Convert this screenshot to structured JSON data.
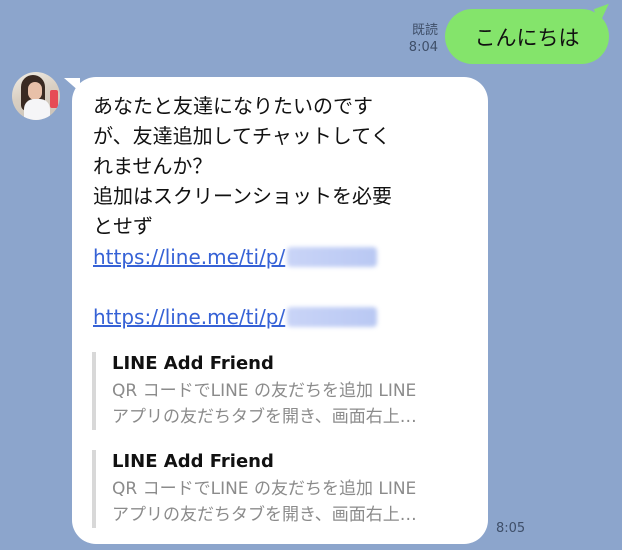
{
  "sent_message": {
    "read_label": "既読",
    "time": "8:04",
    "text": "こんにちは"
  },
  "received_message": {
    "lines": [
      "あなたと友達になりたいのです",
      "が、友達追加してチャットしてく",
      "れませんか？",
      "追加はスクリーンショットを必要",
      "とせず"
    ],
    "links": [
      "https://line.me/ti/p/",
      "https://line.me/ti/p/"
    ],
    "previews": [
      {
        "title": "LINE Add Friend",
        "desc_line1": "QR コードでLINE の友だちを追加 LINE",
        "desc_line2": "アプリの友だちタブを開き、画面右上…"
      },
      {
        "title": "LINE Add Friend",
        "desc_line1": "QR コードでLINE の友だちを追加 LINE",
        "desc_line2": "アプリの友だちタブを開き、画面右上…"
      }
    ],
    "time": "8:05"
  },
  "colors": {
    "background": "#8ca5cc",
    "sent_bubble": "#84e46b",
    "received_bubble": "#ffffff",
    "link": "#3662d6"
  }
}
